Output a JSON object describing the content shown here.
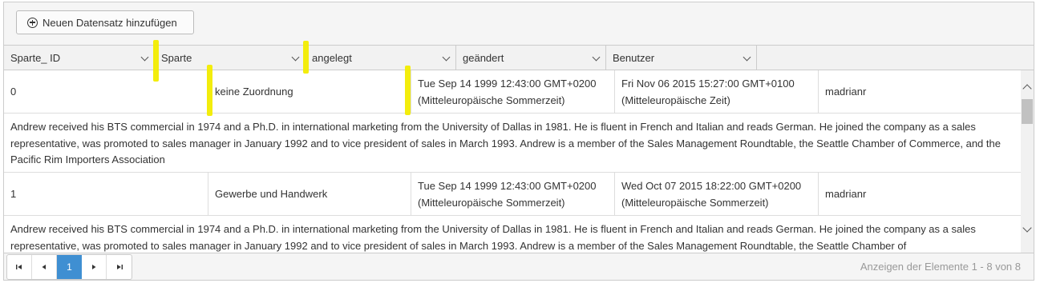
{
  "toolbar": {
    "add_label": "Neuen Datensatz hinzufügen"
  },
  "columns": [
    {
      "label": "Sparte_ ID"
    },
    {
      "label": "Sparte"
    },
    {
      "label": "angelegt"
    },
    {
      "label": "geändert"
    },
    {
      "label": "Benutzer"
    }
  ],
  "rows": [
    {
      "id": "0",
      "sparte": "keine Zuordnung",
      "angelegt_line1": "Tue Sep 14 1999 12:43:00 GMT+0200",
      "angelegt_line2": "(Mitteleuropäische Sommerzeit)",
      "geaendert_line1": "Fri Nov 06 2015 15:27:00 GMT+0100",
      "geaendert_line2": "(Mitteleuropäische Zeit)",
      "benutzer": "madrianr",
      "detail": "Andrew received his BTS commercial in 1974 and a Ph.D. in international marketing from the University of Dallas in 1981. He is fluent in French and Italian and reads German. He joined the company as a sales representative, was promoted to sales manager in January 1992 and to vice president of sales in March 1993. Andrew is a member of the Sales Management Roundtable, the Seattle Chamber of Commerce, and the Pacific Rim Importers Association"
    },
    {
      "id": "1",
      "sparte": "Gewerbe und Handwerk",
      "angelegt_line1": "Tue Sep 14 1999 12:43:00 GMT+0200",
      "angelegt_line2": "(Mitteleuropäische Sommerzeit)",
      "geaendert_line1": "Wed Oct 07 2015 18:22:00 GMT+0200",
      "geaendert_line2": "(Mitteleuropäische Sommerzeit)",
      "benutzer": "madrianr",
      "detail": "Andrew received his BTS commercial in 1974 and a Ph.D. in international marketing from the University of Dallas in 1981. He is fluent in French and Italian and reads German. He joined the company as a sales representative, was promoted to sales manager in January 1992 and to vice president of sales in March 1993. Andrew is a member of the Sales Management Roundtable, the Seattle Chamber of"
    }
  ],
  "pager": {
    "current_page": "1",
    "info": "Anzeigen der Elemente 1 - 8 von 8"
  },
  "colors": {
    "highlight": "#f2ec00",
    "active_page": "#3f8fd2"
  }
}
